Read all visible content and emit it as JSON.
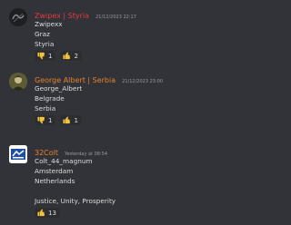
{
  "messages": [
    {
      "author": "Zwipex | Styria",
      "author_color": "#e23b3b",
      "timestamp": "21/12/2023 22:17",
      "lines": [
        "Zwipexx",
        "Graz",
        "Styria"
      ],
      "reactions": [
        {
          "emoji": "thumbs-down-icon",
          "count": "1"
        },
        {
          "emoji": "thumbs-up-icon",
          "count": "2"
        }
      ]
    },
    {
      "author": "George Albert | Serbia",
      "author_color": "#e6822e",
      "timestamp": "21/12/2023 23:00",
      "lines": [
        "George_Albert",
        "Belgrade",
        "Serbia"
      ],
      "reactions": [
        {
          "emoji": "thumbs-down-icon",
          "count": "1"
        },
        {
          "emoji": "thumbs-up-icon",
          "count": "1"
        }
      ]
    },
    {
      "author": "32Colt",
      "author_color": "#e6822e",
      "timestamp": "Yesterday at 08:54",
      "lines": [
        "Colt_44_magnum",
        "Amsterdam",
        "Netherlands",
        "",
        "Justice, Unity, Prosperity"
      ],
      "reactions": [
        {
          "emoji": "thumbs-up-icon",
          "count": "13"
        }
      ]
    }
  ]
}
